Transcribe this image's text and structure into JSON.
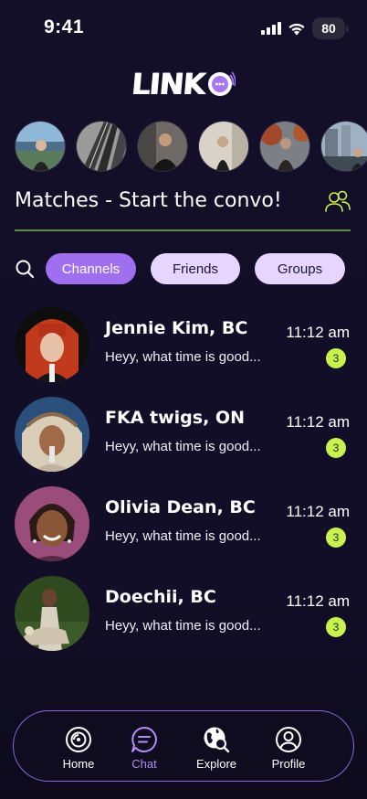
{
  "status": {
    "time": "9:41",
    "battery": "80"
  },
  "logo": {
    "text": "LINK"
  },
  "matches": {
    "title": "Matches - Start the convo!"
  },
  "filters": [
    {
      "label": "Channels",
      "active": true
    },
    {
      "label": "Friends",
      "active": false
    },
    {
      "label": "Groups",
      "active": false
    }
  ],
  "chats": [
    {
      "name": "Jennie Kim, BC",
      "preview": "Heyy, what time is good...",
      "time": "11:12 am",
      "unread": "3"
    },
    {
      "name": "FKA twigs, ON",
      "preview": "Heyy, what time is good...",
      "time": "11:12 am",
      "unread": "3"
    },
    {
      "name": "Olivia Dean, BC",
      "preview": "Heyy, what time is good...",
      "time": "11:12 am",
      "unread": "3"
    },
    {
      "name": "Doechii, BC",
      "preview": "Heyy, what time is good...",
      "time": "11:12 am",
      "unread": "3"
    }
  ],
  "tabs": [
    {
      "label": "Home",
      "icon": "home-icon",
      "active": false
    },
    {
      "label": "Chat",
      "icon": "chat-icon",
      "active": true
    },
    {
      "label": "Explore",
      "icon": "explore-icon",
      "active": false
    },
    {
      "label": "Profile",
      "icon": "profile-icon",
      "active": false
    }
  ],
  "colors": {
    "background": "#130f29",
    "accent": "#9f6ff0",
    "chip_inactive": "#e6d6ff",
    "badge": "#c9f14f",
    "divider": "#5d8a3a"
  }
}
